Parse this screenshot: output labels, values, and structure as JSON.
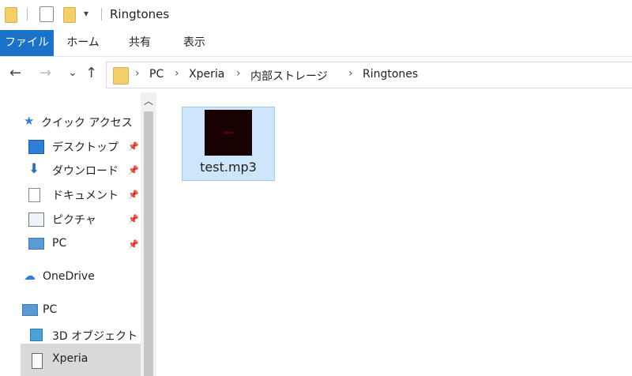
{
  "window": {
    "title": "Ringtones"
  },
  "ribbon": {
    "tabs": [
      "ファイル",
      "ホーム",
      "共有",
      "表示"
    ]
  },
  "nav": {
    "back": "←",
    "forward": "→",
    "recent": "⌄",
    "up": "↑"
  },
  "address": {
    "path": [
      "PC",
      "Xperia",
      "内部ストレージ",
      "Ringtones"
    ],
    "separator": "›"
  },
  "sidebar": {
    "items": [
      {
        "label": "クイック アクセス",
        "icon": "star-icon"
      },
      {
        "label": "デスクトップ",
        "icon": "desktop-icon",
        "pinned": true
      },
      {
        "label": "ダウンロード",
        "icon": "download-icon",
        "pinned": true
      },
      {
        "label": "ドキュメント",
        "icon": "document-icon",
        "pinned": true
      },
      {
        "label": "ピクチャ",
        "icon": "picture-icon",
        "pinned": true
      },
      {
        "label": "PC",
        "icon": "pc-icon",
        "pinned": true
      },
      {
        "label": "OneDrive",
        "icon": "cloud-icon"
      },
      {
        "label": "PC",
        "icon": "pc-icon"
      },
      {
        "label": "3D オブジェクト",
        "icon": "cube-icon"
      },
      {
        "label": "Xperia",
        "icon": "phone-icon",
        "selected": true
      }
    ]
  },
  "files": [
    {
      "name": "test.mp3",
      "selected": true
    }
  ],
  "colors": {
    "accent": "#1a73c8",
    "selection": "#cde6fb",
    "folder": "#f3cf6a"
  }
}
